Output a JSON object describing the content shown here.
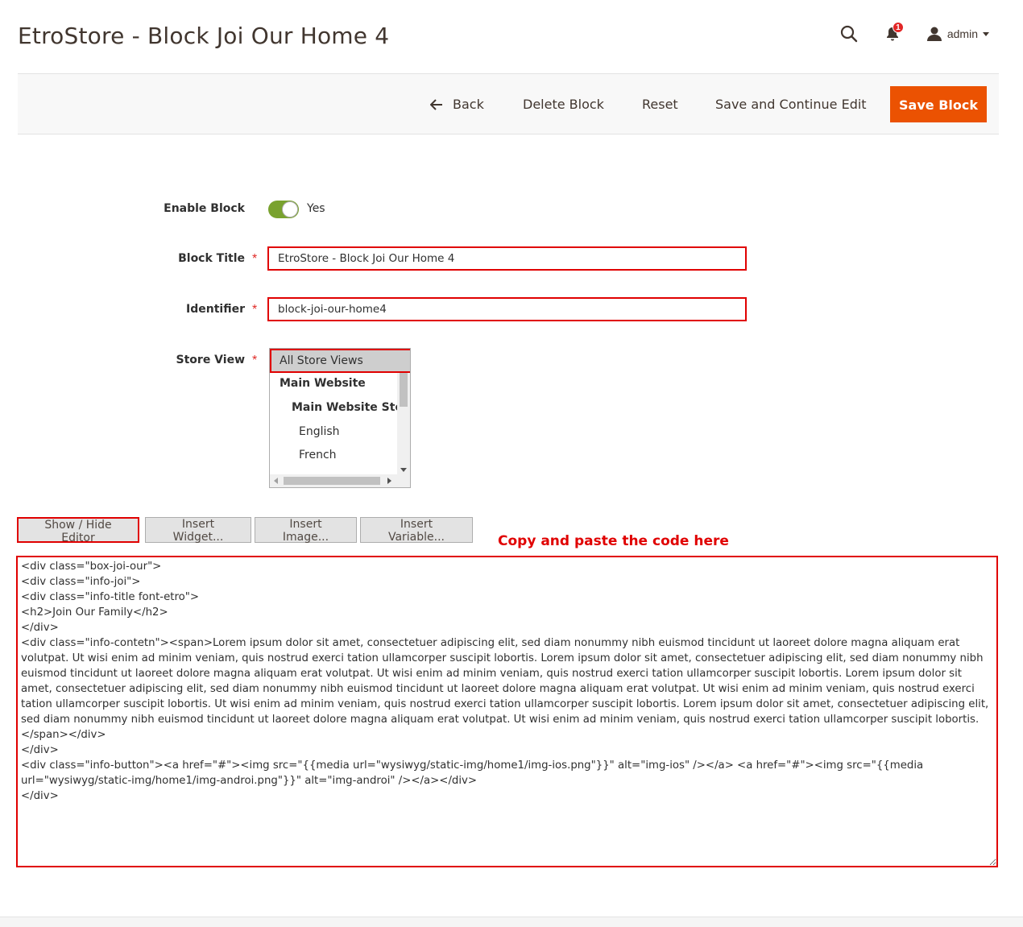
{
  "header": {
    "title": "EtroStore - Block Joi Our Home 4",
    "notifications_count": "1",
    "user_name": "admin"
  },
  "actions": {
    "back_label": "Back",
    "delete_label": "Delete Block",
    "reset_label": "Reset",
    "save_continue_label": "Save and Continue Edit",
    "save_label": "Save Block"
  },
  "form": {
    "enable_label": "Enable Block",
    "enable_value": "Yes",
    "title_label": "Block Title",
    "title_value": "EtroStore - Block Joi Our Home 4",
    "identifier_label": "Identifier",
    "identifier_value": "block-joi-our-home4",
    "store_view_label": "Store View",
    "store_view_options": [
      "All Store Views",
      "Main Website",
      "Main Website Store",
      "English",
      "French"
    ]
  },
  "editor": {
    "show_hide_label": "Show / Hide Editor",
    "insert_widget_label": "Insert Widget...",
    "insert_image_label": "Insert Image...",
    "insert_variable_label": "Insert Variable...",
    "callout": "Copy and paste the code here",
    "content": "<div class=\"box-joi-our\">\n<div class=\"info-joi\">\n<div class=\"info-title font-etro\">\n<h2>Join Our Family</h2>\n</div>\n<div class=\"info-contetn\"><span>Lorem ipsum dolor sit amet, consectetuer adipiscing elit, sed diam nonummy nibh euismod tincidunt ut laoreet dolore magna aliquam erat volutpat. Ut wisi enim ad minim veniam, quis nostrud exerci tation ullamcorper suscipit lobortis. Lorem ipsum dolor sit amet, consectetuer adipiscing elit, sed diam nonummy nibh euismod tincidunt ut laoreet dolore magna aliquam erat volutpat. Ut wisi enim ad minim veniam, quis nostrud exerci tation ullamcorper suscipit lobortis. Lorem ipsum dolor sit amet, consectetuer adipiscing elit, sed diam nonummy nibh euismod tincidunt ut laoreet dolore magna aliquam erat volutpat. Ut wisi enim ad minim veniam, quis nostrud exerci tation ullamcorper suscipit lobortis. Ut wisi enim ad minim veniam, quis nostrud exerci tation ullamcorper suscipit lobortis. Lorem ipsum dolor sit amet, consectetuer adipiscing elit, sed diam nonummy nibh euismod tincidunt ut laoreet dolore magna aliquam erat volutpat. Ut wisi enim ad minim veniam, quis nostrud exerci tation ullamcorper suscipit lobortis. </span></div>\n</div>\n<div class=\"info-button\"><a href=\"#\"><img src=\"{{media url=\"wysiwyg/static-img/home1/img-ios.png\"}}\" alt=\"img-ios\" /></a> <a href=\"#\"><img src=\"{{media url=\"wysiwyg/static-img/home1/img-androi.png\"}}\" alt=\"img-androi\" /></a></div>\n</div>"
  },
  "colors": {
    "accent": "#eb5202",
    "toggle_on": "#79a22e",
    "highlight": "#e00000",
    "notification": "#e22626"
  }
}
